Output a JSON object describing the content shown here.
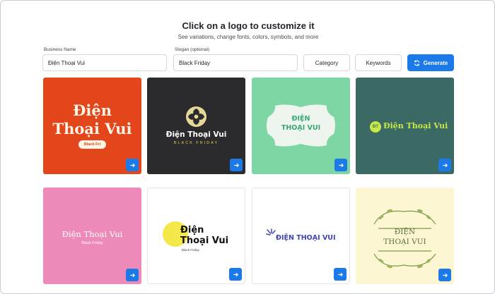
{
  "header": {
    "title": "Click on a logo to customize it",
    "subtitle": "See variations, change fonts, colors, symbols, and more"
  },
  "form": {
    "business_label": "Business Name",
    "business_value": "Điện Thoại Vui",
    "slogan_label": "Slogan (optional)",
    "slogan_value": "Black Friday",
    "category_label": "Category",
    "keywords_label": "Keywords",
    "generate_label": "Generate"
  },
  "colors": {
    "accent": "#1c79e8"
  },
  "logos": [
    {
      "bg": "#e2461a",
      "line1": "Điện",
      "line2": "Thoại Vui",
      "badge": "Black Fri"
    },
    {
      "bg": "#2b2b2d",
      "name": "Điện Thoại Vui",
      "slogan": "BLACK FRIDAY",
      "icon": "swirl-icon"
    },
    {
      "bg": "#7ed6a4",
      "line1": "ĐIỆN",
      "line2": "THOẠI VUI",
      "icon": "frame-shape"
    },
    {
      "bg": "#3a6a63",
      "initials": "ĐT",
      "name": "Điện Thoại Vui"
    },
    {
      "bg": "#ee8ab9",
      "name": "Điện Thoại Vui",
      "slogan": "Black Friday"
    },
    {
      "bg": "#ffffff",
      "line1": "Điện",
      "line2": "Thoại Vui",
      "slogan": "Black Friday"
    },
    {
      "bg": "#ffffff",
      "name": "ĐIỆN THOẠI VUI",
      "icon": "burst-icon"
    },
    {
      "bg": "#fdf6d3",
      "line1": "ĐIỆN",
      "line2": "THOẠI VUI",
      "icon": "vines-icon"
    }
  ]
}
